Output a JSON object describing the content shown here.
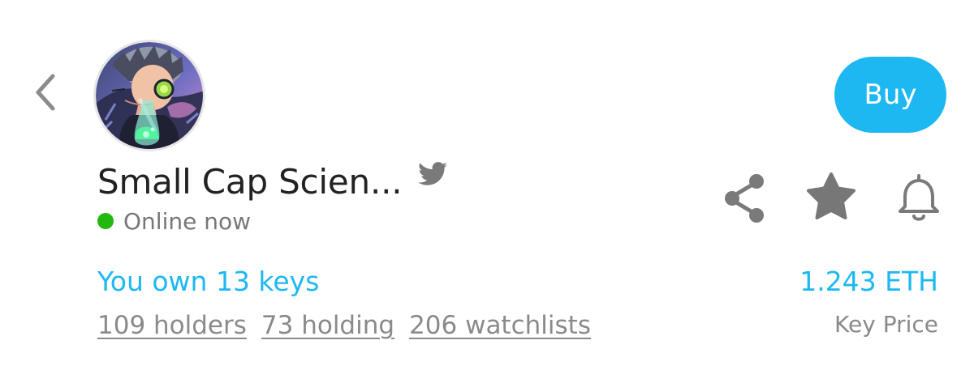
{
  "navigation": {
    "back_icon": "chevron-left-icon"
  },
  "profile": {
    "name": "Small Cap Scien...",
    "social_icon": "twitter-icon",
    "status_text": "Online now",
    "status_color": "#22b80e",
    "avatar_icon": "avatar-illustration"
  },
  "actions": {
    "buy_label": "Buy",
    "accent_color": "#1db8f2",
    "icons": [
      "share-icon",
      "star-icon",
      "bell-icon"
    ]
  },
  "summary": {
    "keys_owned": "You own 13 keys",
    "stats": [
      "109 holders",
      "73 holding",
      "206 watchlists"
    ],
    "key_price_value": "1.243 ETH",
    "key_price_label": "Key Price"
  }
}
